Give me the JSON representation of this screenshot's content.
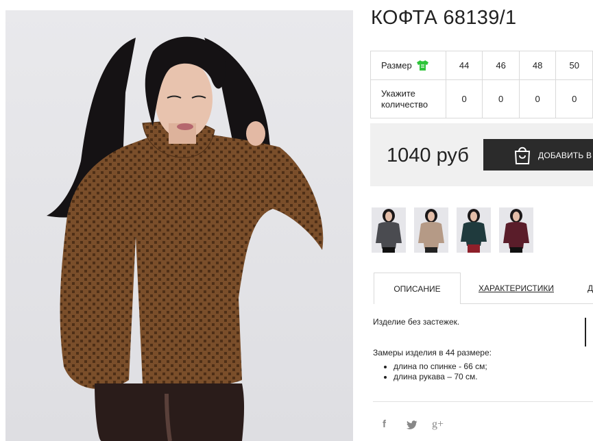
{
  "product": {
    "title": "КОФТА 68139/1",
    "price": "1040 руб",
    "add_to_cart_label": "ДОБАВИТЬ В КОРЗИНУ"
  },
  "size_table": {
    "size_label": "Размер",
    "quantity_label": "Укажите количество",
    "sizes": [
      "44",
      "46",
      "48",
      "50"
    ],
    "quantities": [
      "0",
      "0",
      "0",
      "0"
    ]
  },
  "tabs": {
    "description": "ОПИСАНИЕ",
    "characteristics": "ХАРАКТЕРИСТИКИ",
    "third_partial": "Д"
  },
  "description": {
    "line1": "Изделие без застежек.",
    "measurements_title": "Замеры изделия в 44 размере:",
    "items": [
      "длина по спинке - 66 см;",
      "длина рукава – 70 см."
    ]
  },
  "thumbnails": [
    "grey",
    "beige",
    "dark-green",
    "burgundy"
  ],
  "colors": {
    "sweater_brown": "#7a4e2a",
    "button_dark": "#2b2b2b",
    "size_icon_green": "#2ec43a"
  },
  "icons": {
    "size_icon": "t-shirt-icon",
    "cart_icon": "shopping-bag-icon",
    "social": [
      "facebook-icon",
      "twitter-icon",
      "google-plus-icon"
    ]
  },
  "social_glyphs": {
    "facebook": "f",
    "twitter": "🐦",
    "google_plus": "g+"
  }
}
